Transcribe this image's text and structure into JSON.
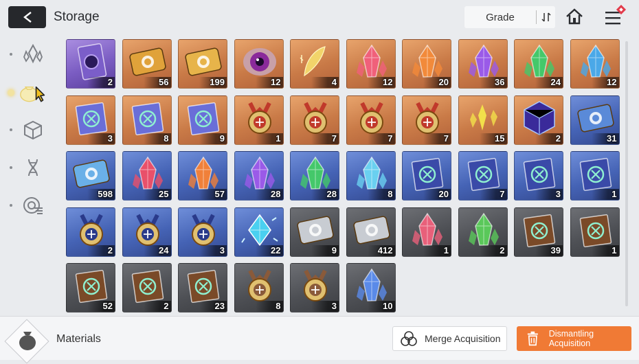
{
  "header": {
    "title": "Storage",
    "grade_label": "Grade",
    "icons": [
      "back-arrow-icon",
      "sort-icon",
      "home-icon",
      "menu-icon"
    ]
  },
  "sidebar": {
    "categories": [
      {
        "name": "crystal-category-icon",
        "active": false
      },
      {
        "name": "materials-bag-category-icon",
        "active": true
      },
      {
        "name": "cube-category-icon",
        "active": false
      },
      {
        "name": "dna-category-icon",
        "active": false
      },
      {
        "name": "chip-category-icon",
        "active": false
      }
    ]
  },
  "items": [
    {
      "grade": "purple",
      "art": "card",
      "color": "#7b5ec9",
      "count": "2"
    },
    {
      "grade": "orange",
      "art": "ticket",
      "color": "#e0a23a",
      "count": "56"
    },
    {
      "grade": "orange",
      "art": "ticket",
      "color": "#e7b44a",
      "count": "199"
    },
    {
      "grade": "orange",
      "art": "eye",
      "color": "#8a2a9a",
      "count": "12"
    },
    {
      "grade": "orange",
      "art": "feather",
      "color": "#f2d46a",
      "count": "4"
    },
    {
      "grade": "orange",
      "art": "crystal",
      "color": "#f0607a",
      "count": "12"
    },
    {
      "grade": "orange",
      "art": "crystal",
      "color": "#f28a3a",
      "count": "20"
    },
    {
      "grade": "orange",
      "art": "crystal",
      "color": "#9a5ae8",
      "count": "36"
    },
    {
      "grade": "orange",
      "art": "crystal",
      "color": "#44c86a",
      "count": "24"
    },
    {
      "grade": "orange",
      "art": "crystal",
      "color": "#4aa8e8",
      "count": "12"
    },
    {
      "grade": "orange",
      "art": "book",
      "color": "#6a6ed8",
      "count": "3"
    },
    {
      "grade": "orange",
      "art": "book",
      "color": "#6a6ed8",
      "count": "8"
    },
    {
      "grade": "orange",
      "art": "book",
      "color": "#6a6ed8",
      "count": "9"
    },
    {
      "grade": "orange",
      "art": "medal",
      "color": "#c0392b",
      "count": "1"
    },
    {
      "grade": "orange",
      "art": "medal",
      "color": "#c0392b",
      "count": "7"
    },
    {
      "grade": "orange",
      "art": "medal",
      "color": "#c0392b",
      "count": "7"
    },
    {
      "grade": "orange",
      "art": "medal",
      "color": "#c0392b",
      "count": "7"
    },
    {
      "grade": "orange",
      "art": "shards",
      "color": "#f2e04a",
      "count": "15"
    },
    {
      "grade": "orange",
      "art": "cube",
      "color": "#3a2a9a",
      "count": "2"
    },
    {
      "grade": "blue",
      "art": "ticket",
      "color": "#5a8ad8",
      "count": "31"
    },
    {
      "grade": "blue",
      "art": "ticket",
      "color": "#6ab0e8",
      "count": "598"
    },
    {
      "grade": "blue",
      "art": "crystal",
      "color": "#e8506a",
      "count": "25"
    },
    {
      "grade": "blue",
      "art": "crystal",
      "color": "#f0803a",
      "count": "57"
    },
    {
      "grade": "blue",
      "art": "crystal",
      "color": "#9a5ae8",
      "count": "28"
    },
    {
      "grade": "blue",
      "art": "crystal",
      "color": "#44c86a",
      "count": "28"
    },
    {
      "grade": "blue",
      "art": "crystal",
      "color": "#6ad0f0",
      "count": "8"
    },
    {
      "grade": "blue",
      "art": "book",
      "color": "#3a4aa8",
      "count": "20"
    },
    {
      "grade": "blue",
      "art": "book",
      "color": "#3a4aa8",
      "count": "7"
    },
    {
      "grade": "blue",
      "art": "book",
      "color": "#3a4aa8",
      "count": "3"
    },
    {
      "grade": "blue",
      "art": "book",
      "color": "#3a4aa8",
      "count": "1"
    },
    {
      "grade": "blue",
      "art": "medal",
      "color": "#2a3a8a",
      "count": "2"
    },
    {
      "grade": "blue",
      "art": "medal",
      "color": "#2a3a8a",
      "count": "24"
    },
    {
      "grade": "blue",
      "art": "medal",
      "color": "#2a3a8a",
      "count": "3"
    },
    {
      "grade": "blue",
      "art": "gem",
      "color": "#4ad0f0",
      "count": "22"
    },
    {
      "grade": "gray",
      "art": "ticket",
      "color": "#c8ccd2",
      "count": "9"
    },
    {
      "grade": "gray",
      "art": "ticket",
      "color": "#c8ccd2",
      "count": "412"
    },
    {
      "grade": "gray",
      "art": "crystal",
      "color": "#e8607a",
      "count": "1"
    },
    {
      "grade": "gray",
      "art": "crystal",
      "color": "#5ac85a",
      "count": "2"
    },
    {
      "grade": "gray",
      "art": "book",
      "color": "#7a4a28",
      "count": "39"
    },
    {
      "grade": "gray",
      "art": "book",
      "color": "#7a4a28",
      "count": "1"
    },
    {
      "grade": "gray",
      "art": "book",
      "color": "#7a4a28",
      "count": "52"
    },
    {
      "grade": "gray",
      "art": "book",
      "color": "#7a4a28",
      "count": "2"
    },
    {
      "grade": "gray",
      "art": "book",
      "color": "#7a4a28",
      "count": "23"
    },
    {
      "grade": "gray",
      "art": "medal",
      "color": "#8a5a3a",
      "count": "8"
    },
    {
      "grade": "gray",
      "art": "medal",
      "color": "#8a5a3a",
      "count": "3"
    },
    {
      "grade": "gray",
      "art": "crystal",
      "color": "#5a8ae8",
      "count": "10"
    }
  ],
  "footer": {
    "materials_label": "Materials",
    "merge_label": "Merge Acquisition",
    "dismantle_label": "Dismantling Acquisition",
    "dismantle_color": "#f07a35"
  }
}
